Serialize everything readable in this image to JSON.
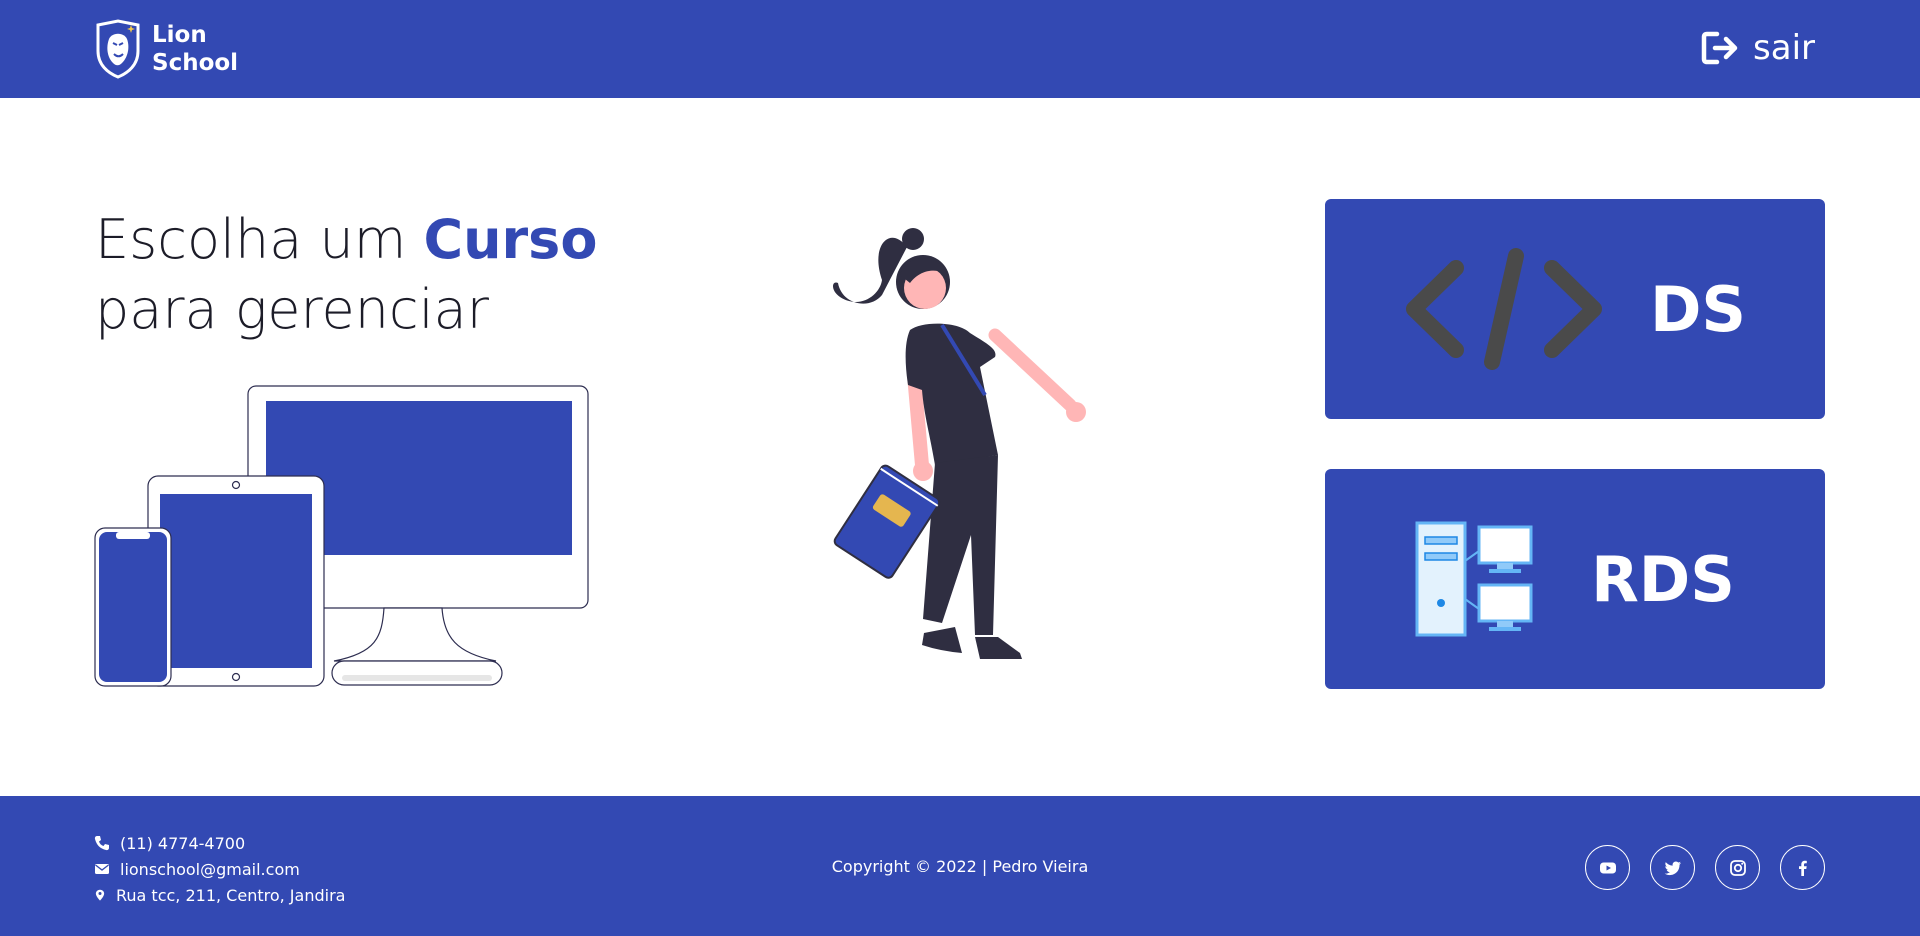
{
  "header": {
    "brand_line1": "Lion",
    "brand_line2": "School",
    "exit_label": "sair"
  },
  "main": {
    "heading_part1": "Escolha um",
    "heading_accent": "Curso",
    "heading_part2": "para gerenciar",
    "courses": [
      {
        "label": "DS",
        "icon": "code-icon"
      },
      {
        "label": "RDS",
        "icon": "network-computer-icon"
      }
    ]
  },
  "footer": {
    "phone": "(11) 4774-4700",
    "email": "lionschool@gmail.com",
    "address": "Rua tcc, 211, Centro, Jandira",
    "copyright": "Copyright © 2022 | Pedro Vieira",
    "socials": [
      "youtube-icon",
      "twitter-icon",
      "instagram-icon",
      "facebook-icon"
    ]
  },
  "colors": {
    "primary": "#3349b3",
    "text": "#1c1c28",
    "white": "#ffffff"
  }
}
